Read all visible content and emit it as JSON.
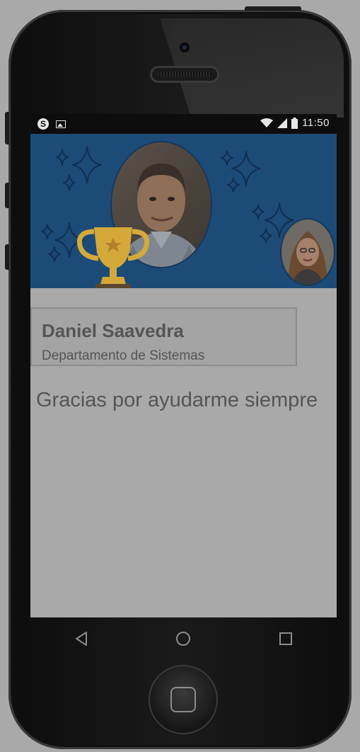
{
  "status_bar": {
    "time": "11:50",
    "left_icons": [
      "skype-icon",
      "image-icon"
    ],
    "right_icons": [
      "wifi-icon",
      "cell-signal-icon",
      "battery-icon"
    ]
  },
  "banner": {
    "background_color": "#1d4b78",
    "decorations": [
      "sparkle-icon",
      "trophy-icon"
    ],
    "recipient_avatar": "recipient-avatar",
    "sender_avatar": "sender-avatar"
  },
  "recipient": {
    "name": "Daniel Saavedra",
    "department": "Departamento de Sistemas"
  },
  "message": "Gracias por ayudarme siempre",
  "navigation": {
    "icons": [
      "back-icon",
      "home-icon",
      "recents-icon"
    ]
  },
  "colors": {
    "overlay_gray": "#a9a9a9",
    "trophy_gold": "#d4a93a",
    "text_gray": "#555555"
  }
}
